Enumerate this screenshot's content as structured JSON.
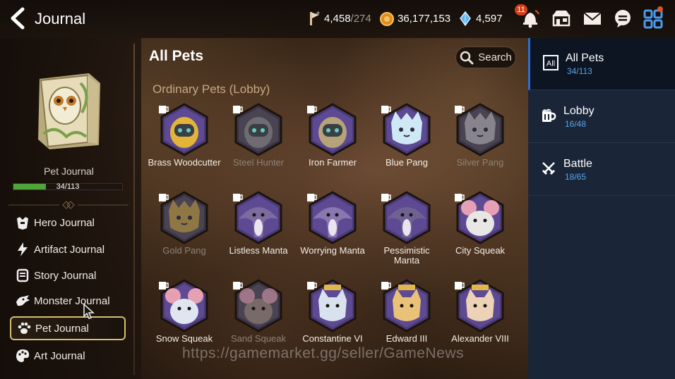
{
  "header": {
    "title": "Journal",
    "stamina": "4,458",
    "stamina_max": "/274",
    "gold": "36,177,153",
    "crystals": "4,597",
    "notification_count": "11"
  },
  "left": {
    "journal_label": "Pet Journal",
    "progress_text": "34/113",
    "progress_fraction": 0.3,
    "menu": [
      {
        "label": "Hero Journal"
      },
      {
        "label": "Artifact Journal"
      },
      {
        "label": "Story Journal"
      },
      {
        "label": "Monster Journal"
      },
      {
        "label": "Pet Journal"
      },
      {
        "label": "Art Journal"
      }
    ]
  },
  "main": {
    "title": "All Pets",
    "search_label": "Search",
    "category": "Ordinary Pets (Lobby)",
    "pets": [
      {
        "name": "Brass Woodcutter",
        "kind": "robot",
        "color": "#e2b53a",
        "owned": true
      },
      {
        "name": "Steel Hunter",
        "kind": "robot",
        "color": "#8c8c8c",
        "owned": false
      },
      {
        "name": "Iron Farmer",
        "kind": "robot",
        "color": "#b7a37a",
        "owned": true
      },
      {
        "name": "Blue Pang",
        "kind": "cat",
        "color": "#cfe8f5",
        "owned": true
      },
      {
        "name": "Silver Pang",
        "kind": "cat",
        "color": "#b9b9bd",
        "owned": false
      },
      {
        "name": "Gold Pang",
        "kind": "cat",
        "color": "#c9a13a",
        "owned": false
      },
      {
        "name": "Listless Manta",
        "kind": "manta",
        "color": "#7c6aa0",
        "owned": true
      },
      {
        "name": "Worrying Manta",
        "kind": "manta",
        "color": "#8a76b0",
        "owned": true
      },
      {
        "name": "Pessimistic Manta",
        "kind": "manta",
        "color": "#6f6292",
        "owned": true
      },
      {
        "name": "City Squeak",
        "kind": "mouse",
        "color": "#e9e6e6",
        "owned": true
      },
      {
        "name": "Snow Squeak",
        "kind": "mouse",
        "color": "#dfe6ef",
        "owned": true
      },
      {
        "name": "Sand Squeak",
        "kind": "mouse",
        "color": "#9c8b7a",
        "owned": false
      },
      {
        "name": "Constantine VI",
        "kind": "royal",
        "color": "#d8e2ee",
        "owned": true
      },
      {
        "name": "Edward III",
        "kind": "royal",
        "color": "#e9c278",
        "owned": true
      },
      {
        "name": "Alexander VIII",
        "kind": "royal",
        "color": "#ecd2b6",
        "owned": true
      }
    ]
  },
  "tabs": [
    {
      "label": "All Pets",
      "count": "34/113",
      "icon": "all-icon"
    },
    {
      "label": "Lobby",
      "count": "16/48",
      "icon": "mug-icon"
    },
    {
      "label": "Battle",
      "count": "18/65",
      "icon": "crossed-swords-icon"
    }
  ],
  "watermark": "https://gamemarket.gg/seller/GameNews",
  "colors": {
    "progress_green": "#4ea53a",
    "tab_accent": "#2a6ed8",
    "count_blue": "#5aa6e8",
    "hex_frame": "#4b3a78",
    "gold_outline": "#d6bd6f"
  }
}
